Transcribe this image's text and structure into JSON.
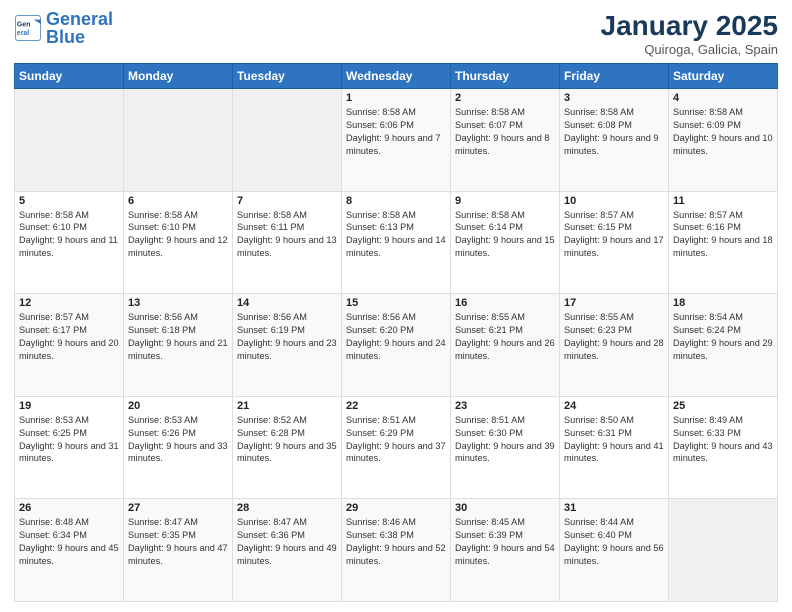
{
  "header": {
    "logo_general": "General",
    "logo_blue": "Blue",
    "month_title": "January 2025",
    "location": "Quiroga, Galicia, Spain"
  },
  "weekdays": [
    "Sunday",
    "Monday",
    "Tuesday",
    "Wednesday",
    "Thursday",
    "Friday",
    "Saturday"
  ],
  "weeks": [
    [
      {
        "day": "",
        "content": ""
      },
      {
        "day": "",
        "content": ""
      },
      {
        "day": "",
        "content": ""
      },
      {
        "day": "1",
        "content": "Sunrise: 8:58 AM\nSunset: 6:06 PM\nDaylight: 9 hours and 7 minutes."
      },
      {
        "day": "2",
        "content": "Sunrise: 8:58 AM\nSunset: 6:07 PM\nDaylight: 9 hours and 8 minutes."
      },
      {
        "day": "3",
        "content": "Sunrise: 8:58 AM\nSunset: 6:08 PM\nDaylight: 9 hours and 9 minutes."
      },
      {
        "day": "4",
        "content": "Sunrise: 8:58 AM\nSunset: 6:09 PM\nDaylight: 9 hours and 10 minutes."
      }
    ],
    [
      {
        "day": "5",
        "content": "Sunrise: 8:58 AM\nSunset: 6:10 PM\nDaylight: 9 hours and 11 minutes."
      },
      {
        "day": "6",
        "content": "Sunrise: 8:58 AM\nSunset: 6:10 PM\nDaylight: 9 hours and 12 minutes."
      },
      {
        "day": "7",
        "content": "Sunrise: 8:58 AM\nSunset: 6:11 PM\nDaylight: 9 hours and 13 minutes."
      },
      {
        "day": "8",
        "content": "Sunrise: 8:58 AM\nSunset: 6:13 PM\nDaylight: 9 hours and 14 minutes."
      },
      {
        "day": "9",
        "content": "Sunrise: 8:58 AM\nSunset: 6:14 PM\nDaylight: 9 hours and 15 minutes."
      },
      {
        "day": "10",
        "content": "Sunrise: 8:57 AM\nSunset: 6:15 PM\nDaylight: 9 hours and 17 minutes."
      },
      {
        "day": "11",
        "content": "Sunrise: 8:57 AM\nSunset: 6:16 PM\nDaylight: 9 hours and 18 minutes."
      }
    ],
    [
      {
        "day": "12",
        "content": "Sunrise: 8:57 AM\nSunset: 6:17 PM\nDaylight: 9 hours and 20 minutes."
      },
      {
        "day": "13",
        "content": "Sunrise: 8:56 AM\nSunset: 6:18 PM\nDaylight: 9 hours and 21 minutes."
      },
      {
        "day": "14",
        "content": "Sunrise: 8:56 AM\nSunset: 6:19 PM\nDaylight: 9 hours and 23 minutes."
      },
      {
        "day": "15",
        "content": "Sunrise: 8:56 AM\nSunset: 6:20 PM\nDaylight: 9 hours and 24 minutes."
      },
      {
        "day": "16",
        "content": "Sunrise: 8:55 AM\nSunset: 6:21 PM\nDaylight: 9 hours and 26 minutes."
      },
      {
        "day": "17",
        "content": "Sunrise: 8:55 AM\nSunset: 6:23 PM\nDaylight: 9 hours and 28 minutes."
      },
      {
        "day": "18",
        "content": "Sunrise: 8:54 AM\nSunset: 6:24 PM\nDaylight: 9 hours and 29 minutes."
      }
    ],
    [
      {
        "day": "19",
        "content": "Sunrise: 8:53 AM\nSunset: 6:25 PM\nDaylight: 9 hours and 31 minutes."
      },
      {
        "day": "20",
        "content": "Sunrise: 8:53 AM\nSunset: 6:26 PM\nDaylight: 9 hours and 33 minutes."
      },
      {
        "day": "21",
        "content": "Sunrise: 8:52 AM\nSunset: 6:28 PM\nDaylight: 9 hours and 35 minutes."
      },
      {
        "day": "22",
        "content": "Sunrise: 8:51 AM\nSunset: 6:29 PM\nDaylight: 9 hours and 37 minutes."
      },
      {
        "day": "23",
        "content": "Sunrise: 8:51 AM\nSunset: 6:30 PM\nDaylight: 9 hours and 39 minutes."
      },
      {
        "day": "24",
        "content": "Sunrise: 8:50 AM\nSunset: 6:31 PM\nDaylight: 9 hours and 41 minutes."
      },
      {
        "day": "25",
        "content": "Sunrise: 8:49 AM\nSunset: 6:33 PM\nDaylight: 9 hours and 43 minutes."
      }
    ],
    [
      {
        "day": "26",
        "content": "Sunrise: 8:48 AM\nSunset: 6:34 PM\nDaylight: 9 hours and 45 minutes."
      },
      {
        "day": "27",
        "content": "Sunrise: 8:47 AM\nSunset: 6:35 PM\nDaylight: 9 hours and 47 minutes."
      },
      {
        "day": "28",
        "content": "Sunrise: 8:47 AM\nSunset: 6:36 PM\nDaylight: 9 hours and 49 minutes."
      },
      {
        "day": "29",
        "content": "Sunrise: 8:46 AM\nSunset: 6:38 PM\nDaylight: 9 hours and 52 minutes."
      },
      {
        "day": "30",
        "content": "Sunrise: 8:45 AM\nSunset: 6:39 PM\nDaylight: 9 hours and 54 minutes."
      },
      {
        "day": "31",
        "content": "Sunrise: 8:44 AM\nSunset: 6:40 PM\nDaylight: 9 hours and 56 minutes."
      },
      {
        "day": "",
        "content": ""
      }
    ]
  ]
}
